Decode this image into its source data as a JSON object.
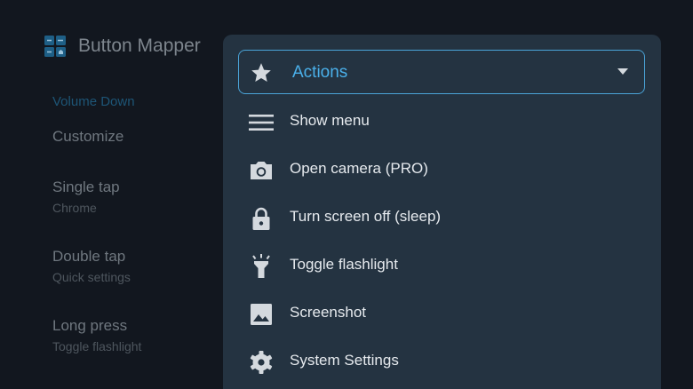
{
  "app": {
    "title": "Button Mapper",
    "icon": "button-mapper-app-icon"
  },
  "background": {
    "section_label": "Volume Down",
    "customize_label": "Customize",
    "items": [
      {
        "title": "Single tap",
        "subtitle": "Chrome"
      },
      {
        "title": "Double tap",
        "subtitle": "Quick settings"
      },
      {
        "title": "Long press",
        "subtitle": "Toggle flashlight"
      }
    ]
  },
  "dialog": {
    "dropdown": {
      "label": "Actions",
      "icon": "star-icon",
      "caret": "dropdown-caret-icon"
    },
    "items": [
      {
        "label": "Show menu",
        "icon": "menu-icon"
      },
      {
        "label": "Open camera (PRO)",
        "icon": "camera-icon"
      },
      {
        "label": "Turn screen off (sleep)",
        "icon": "lock-icon"
      },
      {
        "label": "Toggle flashlight",
        "icon": "flashlight-icon"
      },
      {
        "label": "Screenshot",
        "icon": "image-icon"
      },
      {
        "label": "System Settings",
        "icon": "settings-gear-icon"
      }
    ]
  },
  "colors": {
    "background": "#12171f",
    "dialog": "#243341",
    "accent": "#4ab0ea",
    "menu_text": "#e6eaee",
    "icon": "#d4d9de"
  }
}
